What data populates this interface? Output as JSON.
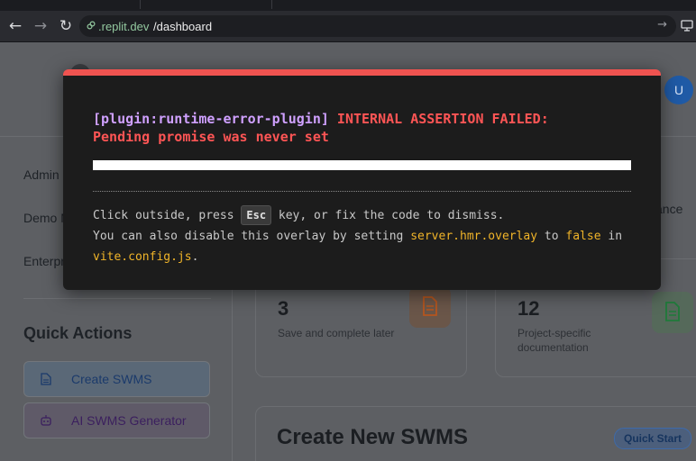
{
  "browser": {
    "url_host": ".replit.dev",
    "url_path": "/dashboard",
    "back_icon": "←",
    "forward_icon": "→",
    "reload_icon": "↻",
    "go_icon": "→"
  },
  "page": {
    "avatar_initial": "U",
    "sidebar": {
      "items": [
        "Admin",
        "Demo M",
        "Enterpr"
      ],
      "quick_actions_title": "Quick Actions",
      "quick_actions": [
        {
          "label": "Create SWMS",
          "icon": "document-icon"
        },
        {
          "label": "AI SWMS Generator",
          "icon": "robot-icon"
        }
      ]
    },
    "cards": [
      {
        "number": "3",
        "description": "Save and complete later",
        "icon": "document-icon"
      },
      {
        "number": "12",
        "description_line1": "Project-specific",
        "description_line2": "documentation",
        "icon": "file-text-icon"
      }
    ],
    "compliance_fragment": "ance",
    "create_title": "Create New SWMS",
    "quick_start_label": "Quick Start"
  },
  "overlay": {
    "plugin": "[plugin:runtime-error-plugin]",
    "message_line1": " INTERNAL ASSERTION FAILED:",
    "message_line2": "Pending promise was never set",
    "tip_prefix": "Click outside, press ",
    "esc_key": "Esc",
    "tip_suffix": " key, or fix the code to dismiss.",
    "tip2_prefix": "You can also disable this overlay by setting ",
    "tip2_setting": "server.hmr.overlay",
    "tip2_to": " to ",
    "tip2_value": "false",
    "tip2_in": " in",
    "tip2_file": "vite.config.js",
    "tip2_end": "."
  },
  "colors": {
    "overlay_accent": "#ef5350",
    "error_text": "#ff5555",
    "plugin_text": "#cfa0ff",
    "code_text": "#f0b429"
  }
}
